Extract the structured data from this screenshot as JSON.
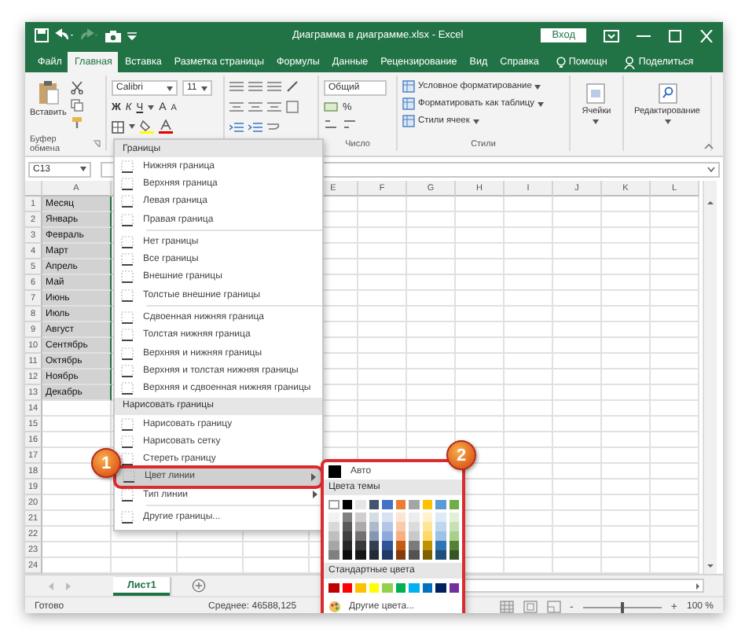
{
  "window": {
    "title": "Диаграмма в диаграмме.xlsx - Excel",
    "sign_in": "Вход"
  },
  "ribbon_tabs": [
    {
      "label": "Файл",
      "selected": false
    },
    {
      "label": "Главная",
      "selected": true
    },
    {
      "label": "Вставка",
      "selected": false
    },
    {
      "label": "Разметка страницы",
      "selected": false
    },
    {
      "label": "Формулы",
      "selected": false
    },
    {
      "label": "Данные",
      "selected": false
    },
    {
      "label": "Рецензирование",
      "selected": false
    },
    {
      "label": "Вид",
      "selected": false
    },
    {
      "label": "Справка",
      "selected": false
    }
  ],
  "tell_me": "Помощн",
  "share": "Поделиться",
  "ribbon": {
    "paste": "Вставить",
    "clipboard_label": "Буфер обмена",
    "font_name": "Calibri",
    "font_size": "11",
    "bold": "Ж",
    "italic": "К",
    "underline": "Ч",
    "grow_font": "A",
    "shrink_font": "A",
    "number_format": "Общий",
    "percent": "%",
    "number_label": "Число",
    "styles": [
      "Условное форматирование",
      "Форматировать как таблицу",
      "Стили ячеек"
    ],
    "styles_label": "Стили",
    "cells": "Ячейки",
    "editing": "Редактирование"
  },
  "name_box": "C13",
  "columns": [
    "A",
    "E",
    "F",
    "G",
    "H",
    "I",
    "J",
    "K",
    "L"
  ],
  "rows": [
    {
      "number": "1",
      "value": "Месяц",
      "selected": true
    },
    {
      "number": "2",
      "value": "Январь",
      "selected": true
    },
    {
      "number": "3",
      "value": "Февраль",
      "selected": true
    },
    {
      "number": "4",
      "value": "Март",
      "selected": true
    },
    {
      "number": "5",
      "value": "Апрель",
      "selected": true
    },
    {
      "number": "6",
      "value": "Май",
      "selected": true
    },
    {
      "number": "7",
      "value": "Июнь",
      "selected": true
    },
    {
      "number": "8",
      "value": "Июль",
      "selected": true
    },
    {
      "number": "9",
      "value": "Август",
      "selected": true
    },
    {
      "number": "10",
      "value": "Сентябрь",
      "selected": true
    },
    {
      "number": "11",
      "value": "Октябрь",
      "selected": true
    },
    {
      "number": "12",
      "value": "Ноябрь",
      "selected": true
    },
    {
      "number": "13",
      "value": "Декабрь",
      "selected": true
    },
    {
      "number": "14",
      "selected": false
    },
    {
      "number": "15",
      "selected": false
    },
    {
      "number": "16",
      "selected": false
    },
    {
      "number": "17",
      "selected": false
    },
    {
      "number": "18",
      "selected": false
    },
    {
      "number": "19",
      "selected": false
    },
    {
      "number": "20",
      "selected": false
    },
    {
      "number": "21",
      "selected": false
    },
    {
      "number": "22",
      "selected": false
    },
    {
      "number": "23",
      "selected": false
    },
    {
      "number": "24",
      "selected": false
    }
  ],
  "menu": {
    "title": "Границы",
    "items": [
      {
        "kind": "item",
        "label": "Нижняя граница",
        "highlighted": false,
        "submenu": false
      },
      {
        "kind": "item",
        "label": "Верхняя граница",
        "highlighted": false,
        "submenu": false
      },
      {
        "kind": "item",
        "label": "Левая граница",
        "highlighted": false,
        "submenu": false
      },
      {
        "kind": "item",
        "label": "Правая граница",
        "highlighted": false,
        "submenu": false
      },
      {
        "kind": "separator"
      },
      {
        "kind": "item",
        "label": "Нет границы",
        "highlighted": false,
        "submenu": false
      },
      {
        "kind": "item",
        "label": "Все границы",
        "highlighted": false,
        "submenu": false
      },
      {
        "kind": "item",
        "label": "Внешние границы",
        "highlighted": false,
        "submenu": false
      },
      {
        "kind": "item",
        "label": "Толстые внешние границы",
        "highlighted": false,
        "submenu": false
      },
      {
        "kind": "separator"
      },
      {
        "kind": "item",
        "label": "Сдвоенная нижняя граница",
        "highlighted": false,
        "submenu": false
      },
      {
        "kind": "item",
        "label": "Толстая нижняя граница",
        "highlighted": false,
        "submenu": false
      },
      {
        "kind": "item",
        "label": "Верхняя и нижняя границы",
        "highlighted": false,
        "submenu": false
      },
      {
        "kind": "item",
        "label": "Верхняя и толстая нижняя границы",
        "highlighted": false,
        "submenu": false
      },
      {
        "kind": "item",
        "label": "Верхняя и сдвоенная нижняя границы",
        "highlighted": false,
        "submenu": false
      },
      {
        "kind": "header",
        "label": "Нарисовать границы"
      },
      {
        "kind": "item",
        "label": "Нарисовать границу",
        "highlighted": false,
        "submenu": false
      },
      {
        "kind": "item",
        "label": "Нарисовать сетку",
        "highlighted": false,
        "submenu": false
      },
      {
        "kind": "item",
        "label": "Стереть границу",
        "highlighted": false,
        "submenu": false
      },
      {
        "kind": "item",
        "label": "Цвет линии",
        "highlighted": true,
        "submenu": true
      },
      {
        "kind": "item",
        "label": "Тип линии",
        "highlighted": false,
        "submenu": true
      },
      {
        "kind": "separator"
      },
      {
        "kind": "item",
        "label": "Другие границы...",
        "highlighted": false,
        "submenu": false
      }
    ]
  },
  "submenu": {
    "auto": "Авто",
    "theme_title": "Цвета темы",
    "theme_rows": [
      [
        {
          "color": "#ffffff"
        },
        {
          "color": "#000000"
        },
        {
          "color": "#e7e6e6"
        },
        {
          "color": "#44546a"
        },
        {
          "color": "#4472c4"
        },
        {
          "color": "#ed7d31"
        },
        {
          "color": "#a5a5a5"
        },
        {
          "color": "#ffc000"
        },
        {
          "color": "#5b9bd5"
        },
        {
          "color": "#70ad47"
        }
      ],
      [
        {
          "color": "#f2f2f2"
        },
        {
          "color": "#808080"
        },
        {
          "color": "#d0cece"
        },
        {
          "color": "#d6dce4"
        },
        {
          "color": "#d9e2f3"
        },
        {
          "color": "#fbe5d5"
        },
        {
          "color": "#ededed"
        },
        {
          "color": "#fff2cc"
        },
        {
          "color": "#deebf6"
        },
        {
          "color": "#e2efd9"
        }
      ],
      [
        {
          "color": "#d9d9d9"
        },
        {
          "color": "#595959"
        },
        {
          "color": "#aeaaaa"
        },
        {
          "color": "#adb9ca"
        },
        {
          "color": "#b4c6e7"
        },
        {
          "color": "#f7cbac"
        },
        {
          "color": "#dbdbdb"
        },
        {
          "color": "#fee599"
        },
        {
          "color": "#bdd7ee"
        },
        {
          "color": "#c5e0b3"
        }
      ],
      [
        {
          "color": "#bfbfbf"
        },
        {
          "color": "#404040"
        },
        {
          "color": "#757171"
        },
        {
          "color": "#8497b0"
        },
        {
          "color": "#8eaadb"
        },
        {
          "color": "#f4b183"
        },
        {
          "color": "#c9c9c9"
        },
        {
          "color": "#ffd965"
        },
        {
          "color": "#9cc3e5"
        },
        {
          "color": "#a8d08d"
        }
      ],
      [
        {
          "color": "#a6a6a6"
        },
        {
          "color": "#262626"
        },
        {
          "color": "#3a3838"
        },
        {
          "color": "#333f4f"
        },
        {
          "color": "#2f5496"
        },
        {
          "color": "#c55a11"
        },
        {
          "color": "#7b7b7b"
        },
        {
          "color": "#bf9000"
        },
        {
          "color": "#2e75b5"
        },
        {
          "color": "#538135"
        }
      ],
      [
        {
          "color": "#808080"
        },
        {
          "color": "#0d0d0d"
        },
        {
          "color": "#171616"
        },
        {
          "color": "#222a35"
        },
        {
          "color": "#1f3864"
        },
        {
          "color": "#833c0b"
        },
        {
          "color": "#525252"
        },
        {
          "color": "#7f6000"
        },
        {
          "color": "#1e4e79"
        },
        {
          "color": "#375623"
        }
      ]
    ],
    "standard_title": "Стандартные цвета",
    "standard": [
      {
        "color": "#c00000"
      },
      {
        "color": "#ff0000"
      },
      {
        "color": "#ffc000"
      },
      {
        "color": "#ffff00"
      },
      {
        "color": "#92d050"
      },
      {
        "color": "#00b050"
      },
      {
        "color": "#00b0f0"
      },
      {
        "color": "#0070c0"
      },
      {
        "color": "#002060"
      },
      {
        "color": "#7030a0"
      }
    ],
    "more": "Другие цвета..."
  },
  "annotations": [
    "1",
    "2"
  ],
  "sheet_tabs": [
    {
      "label": "Лист1",
      "selected": true
    }
  ],
  "status": {
    "ready": "Готово",
    "average": "Среднее: 46588,125",
    "zoom_minus": "-",
    "zoom_plus": "+",
    "zoom": "100 %",
    "zoom_slider": {
      "level": 0.5
    }
  }
}
